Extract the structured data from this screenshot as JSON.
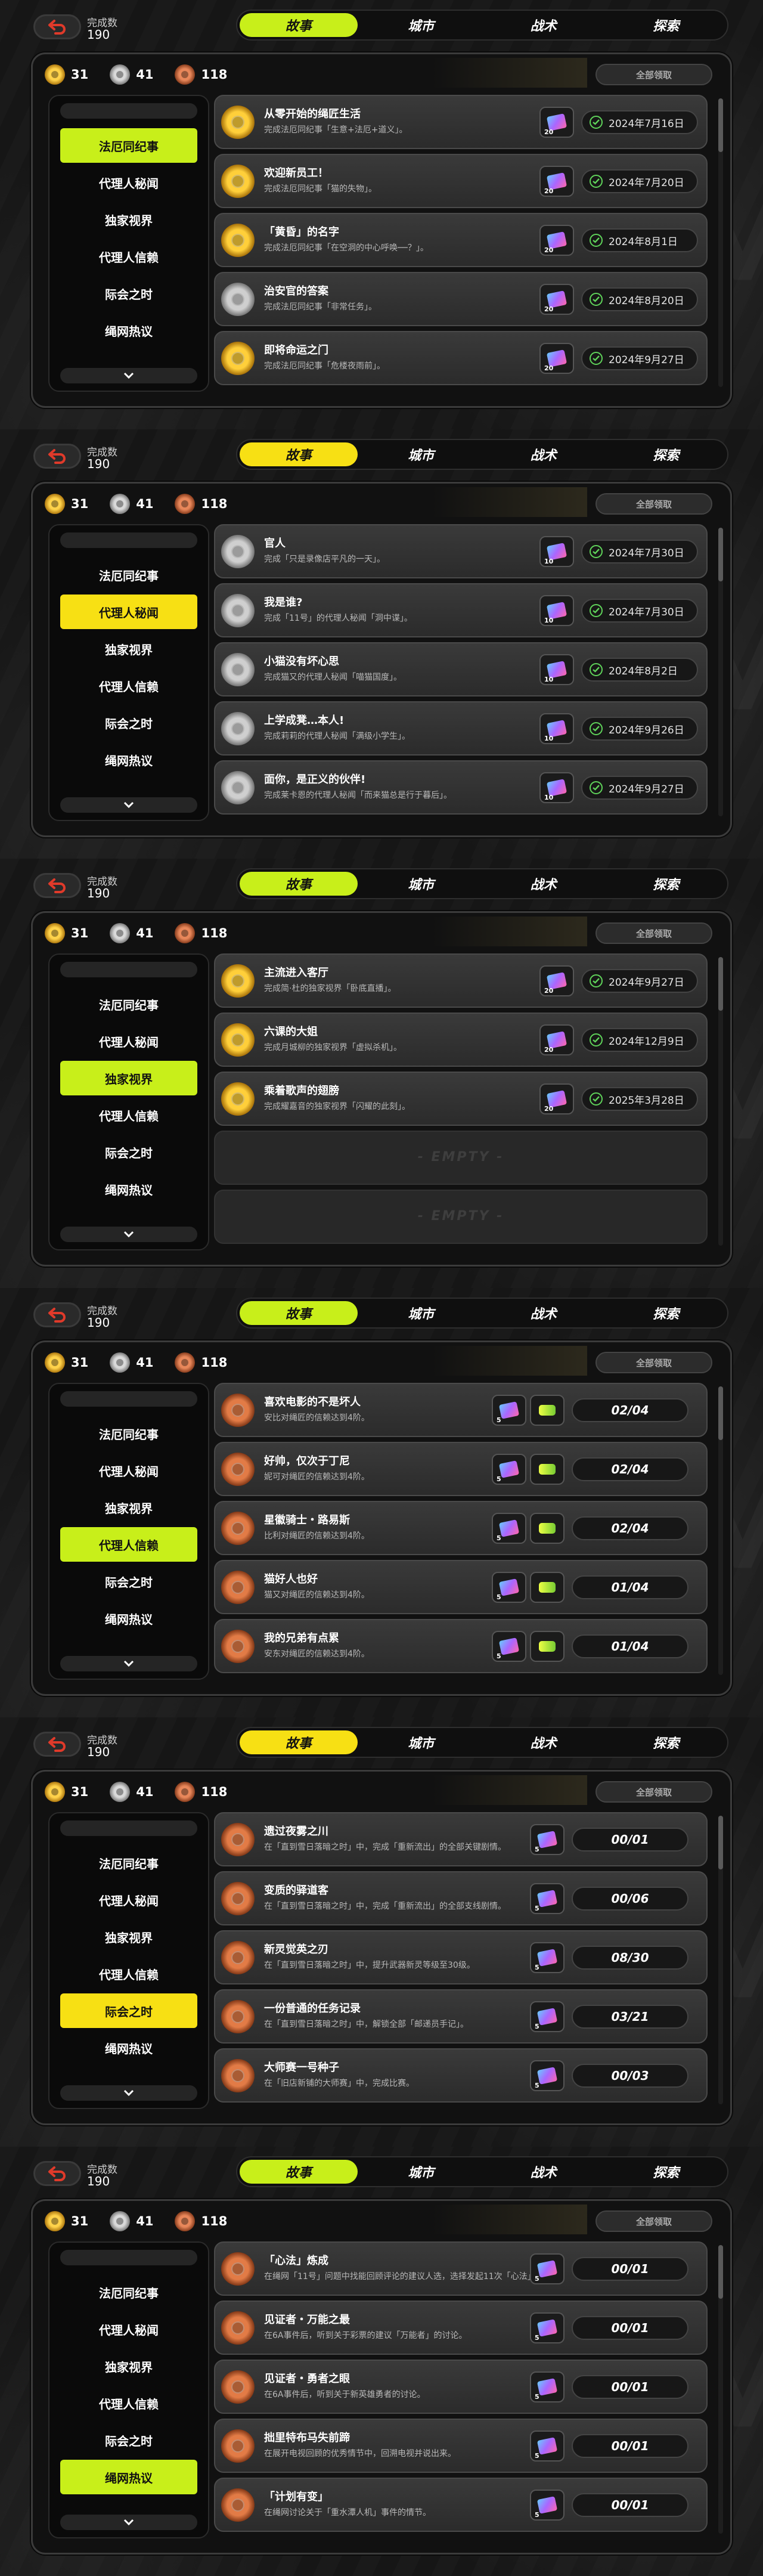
{
  "common": {
    "count_label": "完成数",
    "count_value": "190",
    "tabs": [
      "故事",
      "城市",
      "战术",
      "探索"
    ],
    "stats": [
      "31",
      "41",
      "118"
    ],
    "claim_all": "全部领取",
    "side": [
      "法厄同纪事",
      "代理人秘闻",
      "独家视界",
      "代理人信赖",
      "际会之时",
      "绳网热议"
    ],
    "empty_label": "- EMPTY -"
  },
  "colors": {
    "lime": "#c8ef1a",
    "yellow": "#f7e014",
    "check": "#5fd35a"
  },
  "screens": [
    {
      "accent": "lime",
      "active_side": 0,
      "rows": [
        {
          "medal": "gold",
          "title": "从零开始的绳匠生活",
          "desc": "完成法厄同纪事「生意+法厄+道义」。",
          "qty": "20",
          "right": "2024年7月16日"
        },
        {
          "medal": "gold",
          "title": "欢迎新员工！",
          "desc": "完成法厄同纪事「猫的失物」。",
          "qty": "20",
          "right": "2024年7月20日"
        },
        {
          "medal": "gold",
          "title": "「黄昏」的名字",
          "desc": "完成法厄同纪事「在空洞的中心呼唤──？」。",
          "qty": "20",
          "right": "2024年8月1日"
        },
        {
          "medal": "silver",
          "title": "治安官的答案",
          "desc": "完成法厄同纪事「非常任务」。",
          "qty": "20",
          "right": "2024年8月20日"
        },
        {
          "medal": "gold",
          "title": "即将命运之门",
          "desc": "完成法厄同纪事「危楼夜雨前」。",
          "qty": "20",
          "right": "2024年9月27日"
        }
      ]
    },
    {
      "accent": "yellow",
      "active_side": 1,
      "rows": [
        {
          "medal": "silver",
          "title": "官人",
          "desc": "完成「只是录像店平凡的一天」。",
          "qty": "10",
          "right": "2024年7月30日"
        },
        {
          "medal": "silver",
          "title": "我是谁?",
          "desc": "完成「11号」的代理人秘闻「洞中谍」。",
          "qty": "10",
          "right": "2024年7月30日"
        },
        {
          "medal": "silver",
          "title": "小猫没有坏心思",
          "desc": "完成猫又的代理人秘闻「喵猫国度」。",
          "qty": "10",
          "right": "2024年8月2日"
        },
        {
          "medal": "silver",
          "title": "上学成凳…本人!",
          "desc": "完成莉莉的代理人秘闻「满级小学生」。",
          "qty": "10",
          "right": "2024年9月26日"
        },
        {
          "medal": "silver",
          "title": "面你，是正义的伙伴!",
          "desc": "完成莱卡恩的代理人秘闻「而来猫总是行于暮后」。",
          "qty": "10",
          "right": "2024年9月27日"
        }
      ]
    },
    {
      "accent": "lime",
      "active_side": 2,
      "rows": [
        {
          "medal": "gold",
          "title": "主流进入客厅",
          "desc": "完成简·杜的独家视界「卧底直播」。",
          "qty": "20",
          "right": "2024年9月27日"
        },
        {
          "medal": "gold",
          "title": "六课的大姐",
          "desc": "完成月城柳的独家视界「虚拟杀机」。",
          "qty": "20",
          "right": "2024年12月9日"
        },
        {
          "medal": "gold",
          "title": "乘着歌声的翅膀",
          "desc": "完成耀嘉音的独家视界「闪耀的此刻」。",
          "qty": "20",
          "right": "2025年3月28日"
        },
        {
          "empty": true
        },
        {
          "empty": true
        }
      ]
    },
    {
      "accent": "lime",
      "active_side": 3,
      "rows": [
        {
          "medal": "bronze",
          "title": "喜欢电影的不是坏人",
          "desc": "安比对绳匠的信赖达到4阶。",
          "qty": "5",
          "right": "02/04",
          "reward2": true
        },
        {
          "medal": "bronze",
          "title": "好帅，仅次于丁尼",
          "desc": "妮可对绳匠的信赖达到4阶。",
          "qty": "5",
          "right": "02/04",
          "reward2": true
        },
        {
          "medal": "bronze",
          "title": "星徽骑士・路易斯",
          "desc": "比利对绳匠的信赖达到4阶。",
          "qty": "5",
          "right": "02/04",
          "reward2": true
        },
        {
          "medal": "bronze",
          "title": "猫好人也好",
          "desc": "猫又对绳匠的信赖达到4阶。",
          "qty": "5",
          "right": "01/04",
          "reward2": true
        },
        {
          "medal": "bronze",
          "title": "我的兄弟有点累",
          "desc": "安东对绳匠的信赖达到4阶。",
          "qty": "5",
          "right": "01/04",
          "reward2": true
        }
      ]
    },
    {
      "accent": "yellow",
      "active_side": 4,
      "rows": [
        {
          "medal": "bronze",
          "title": "遗过夜雾之川",
          "desc": "在「直到雪日落暗之时」中，完成「重新流出」的全部关键剧情。",
          "qty": "5",
          "right": "00/01"
        },
        {
          "medal": "bronze",
          "title": "变质的驿道客",
          "desc": "在「直到雪日落暗之时」中，完成「重新流出」的全部支线剧情。",
          "qty": "5",
          "right": "00/06"
        },
        {
          "medal": "bronze",
          "title": "新灵觉英之刃",
          "desc": "在「直到雪日落暗之时」中，提升武器新灵等级至30级。",
          "qty": "5",
          "right": "08/30"
        },
        {
          "medal": "bronze",
          "title": "一份普通的任务记录",
          "desc": "在「直到雪日落暗之时」中，解锁全部「邮递员手记」。",
          "qty": "5",
          "right": "03/21"
        },
        {
          "medal": "bronze",
          "title": "大师赛一号种子",
          "desc": "在「旧店新铺的大师赛」中，完成比赛。",
          "qty": "5",
          "right": "00/03"
        }
      ]
    },
    {
      "accent": "lime",
      "active_side": 5,
      "rows": [
        {
          "medal": "bronze",
          "title": "「心法」炼成",
          "desc": "在绳网「11号」问题中找能回顾评论的建议人选，选择发起11次「心法」。",
          "qty": "5",
          "right": "00/01"
        },
        {
          "medal": "bronze",
          "title": "见证者・万能之最",
          "desc": "在6A事件后，听到关于彩票的建议「万能者」的讨论。",
          "qty": "5",
          "right": "00/01"
        },
        {
          "medal": "bronze",
          "title": "见证者・勇者之眼",
          "desc": "在6A事件后，听到关于新英雄勇者的讨论。",
          "qty": "5",
          "right": "00/01"
        },
        {
          "medal": "bronze",
          "title": "拙里特布马失前蹄",
          "desc": "在展开电视回顾的优秀情节中，回溯电视并说出来。",
          "qty": "5",
          "right": "00/01"
        },
        {
          "medal": "bronze",
          "title": "「计划有变」",
          "desc": "在绳网讨论关于「重水潭人机」事件的情节。",
          "qty": "5",
          "right": "00/01"
        }
      ]
    }
  ]
}
